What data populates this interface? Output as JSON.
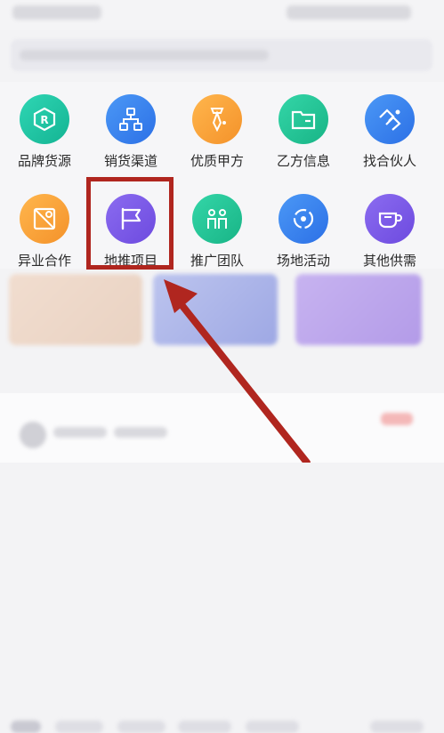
{
  "menu": {
    "row1": [
      {
        "label": "品牌货源",
        "icon": "brand-source-icon",
        "color": "#1fc3a4"
      },
      {
        "label": "销货渠道",
        "icon": "sales-channel-icon",
        "color": "#3a86f0"
      },
      {
        "label": "优质甲方",
        "icon": "quality-client-icon",
        "color": "#f6a23a"
      },
      {
        "label": "乙方信息",
        "icon": "vendor-info-icon",
        "color": "#22c49a"
      },
      {
        "label": "找合伙人",
        "icon": "find-partner-icon",
        "color": "#3a86f0"
      }
    ],
    "row2": [
      {
        "label": "异业合作",
        "icon": "cross-industry-icon",
        "color": "#f6a23a"
      },
      {
        "label": "地推项目",
        "icon": "flag-icon",
        "color": "#7a5ae6"
      },
      {
        "label": "推广团队",
        "icon": "team-icon",
        "color": "#22c49a"
      },
      {
        "label": "场地活动",
        "icon": "venue-activity-icon",
        "color": "#3a86f0"
      },
      {
        "label": "其他供需",
        "icon": "cup-icon",
        "color": "#7a5ae6"
      }
    ]
  },
  "annotation": {
    "highlight_color": "#b0261f",
    "highlighted_item": "地推项目"
  }
}
